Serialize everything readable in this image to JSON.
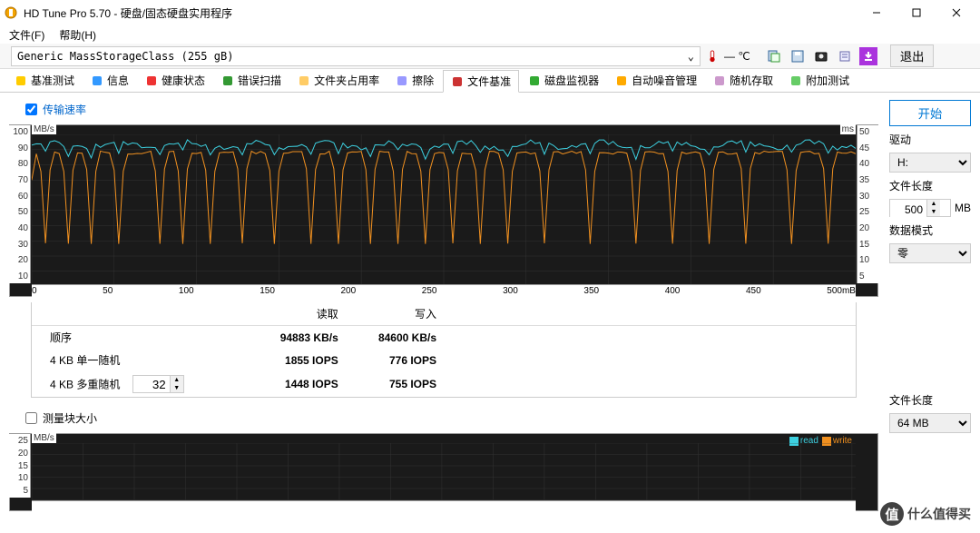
{
  "title": "HD Tune Pro 5.70 - 硬盘/固态硬盘实用程序",
  "menu": {
    "file": "文件(F)",
    "help": "帮助(H)"
  },
  "device": "Generic MassStorageClass (255 gB)",
  "temp": "— ℃",
  "exit": "退出",
  "tabs": [
    {
      "label": "基准测试",
      "icon": "bulb"
    },
    {
      "label": "信息",
      "icon": "info"
    },
    {
      "label": "健康状态",
      "icon": "heart"
    },
    {
      "label": "错误扫描",
      "icon": "search"
    },
    {
      "label": "文件夹占用率",
      "icon": "folder"
    },
    {
      "label": "擦除",
      "icon": "eraser"
    },
    {
      "label": "文件基准",
      "icon": "file",
      "active": true
    },
    {
      "label": "磁盘监视器",
      "icon": "chart"
    },
    {
      "label": "自动噪音管理",
      "icon": "speaker"
    },
    {
      "label": "随机存取",
      "icon": "random"
    },
    {
      "label": "附加测试",
      "icon": "extra"
    }
  ],
  "chk1": "传输速率",
  "chk2": "测量块大小",
  "chart1": {
    "ylabel_left": "MB/s",
    "ylabel_right": "ms",
    "yticks_left": [
      "100",
      "90",
      "80",
      "70",
      "60",
      "50",
      "40",
      "30",
      "20",
      "10"
    ],
    "yticks_right": [
      "50",
      "45",
      "40",
      "35",
      "30",
      "25",
      "20",
      "15",
      "10",
      "5"
    ],
    "xticks": [
      "0",
      "50",
      "100",
      "150",
      "200",
      "250",
      "300",
      "350",
      "400",
      "450",
      "500mB"
    ]
  },
  "results": {
    "head_read": "读取",
    "head_write": "写入",
    "rows": [
      {
        "label": "顺序",
        "read": "94883 KB/s",
        "write": "84600 KB/s"
      },
      {
        "label": "4 KB 单一随机",
        "read": "1855 IOPS",
        "write": "776 IOPS"
      },
      {
        "label": "4 KB 多重随机",
        "spin": "32",
        "read": "1448 IOPS",
        "write": "755 IOPS"
      }
    ]
  },
  "chart2": {
    "ylabel_left": "MB/s",
    "yticks_left": [
      "25",
      "20",
      "15",
      "10",
      "5"
    ],
    "legend_read": "read",
    "legend_write": "write"
  },
  "sidebar": {
    "start": "开始",
    "drive_label": "驱动",
    "drive": "H:",
    "flen_label": "文件长度",
    "flen": "500",
    "flen_unit": "MB",
    "mode_label": "数据模式",
    "mode": "零",
    "flen2_label": "文件长度",
    "flen2": "64 MB"
  },
  "watermark": "什么值得买",
  "chart_data": {
    "type": "line",
    "title": "传输速率",
    "xlabel": "mB",
    "ylabel_left": "MB/s",
    "ylabel_right": "ms",
    "xlim": [
      0,
      500
    ],
    "ylim_left": [
      0,
      100
    ],
    "ylim_right": [
      0,
      50
    ],
    "series": [
      {
        "name": "read (cyan)",
        "axis": "left",
        "approx_mean": 93,
        "approx_min": 85,
        "approx_max": 96,
        "note": "fluctuates 85–96 MB/s with small periodic dips"
      },
      {
        "name": "write (orange)",
        "axis": "left",
        "approx_mean": 88,
        "approx_min": 30,
        "approx_max": 92,
        "note": "mostly ~88 MB/s with ~20 sharp downward spikes to 30–55 MB/s distributed across 0–500"
      }
    ]
  }
}
